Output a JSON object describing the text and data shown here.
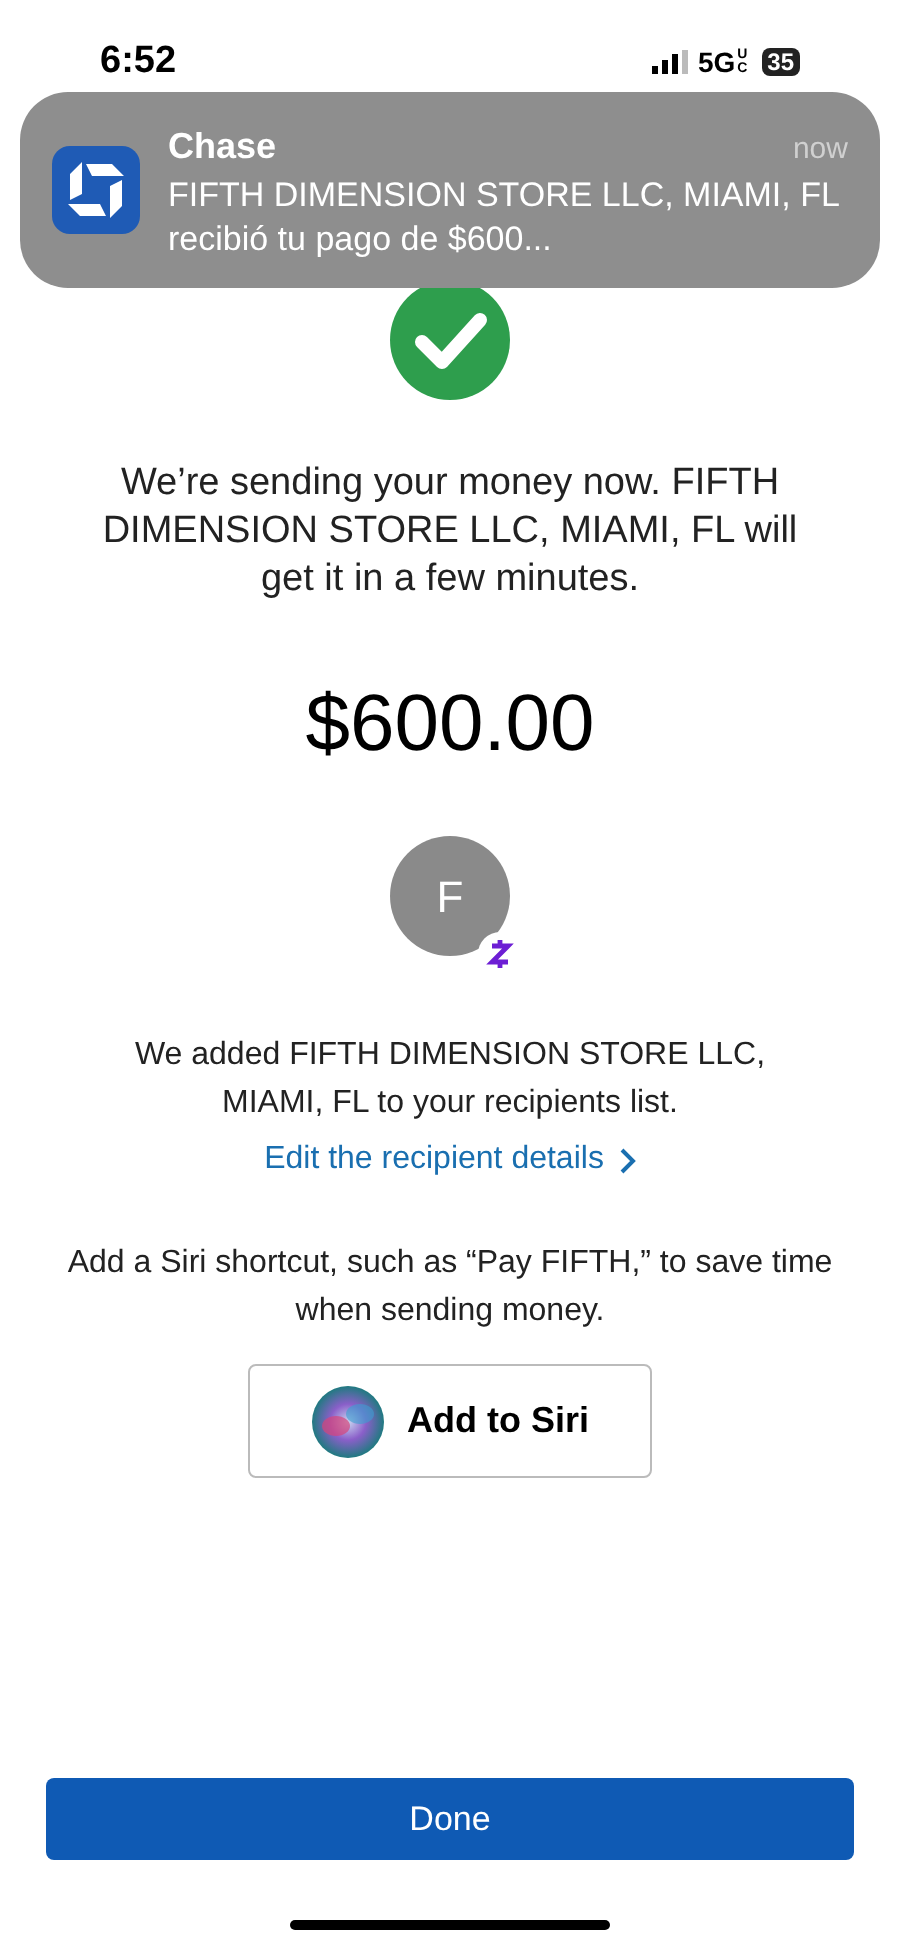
{
  "status_bar": {
    "time": "6:52",
    "network": "5G",
    "network_sub": "UC",
    "battery": "35"
  },
  "notification": {
    "app": "Chase",
    "time": "now",
    "message": "FIFTH DIMENSION STORE LLC, MIAMI, FL recibió tu pago de $600..."
  },
  "confirmation": {
    "message": "We’re sending your money now. FIFTH DIMENSION STORE LLC, MIAMI, FL will get it in a few minutes.",
    "amount": "$600.00"
  },
  "recipient": {
    "initial": "F",
    "added_message": "We added FIFTH DIMENSION STORE LLC, MIAMI, FL to your recipients list.",
    "edit_link": "Edit the recipient details"
  },
  "siri": {
    "message": "Add a Siri shortcut, such as “Pay FIFTH,” to save time when sending money.",
    "button": "Add to Siri"
  },
  "done_button": "Done"
}
